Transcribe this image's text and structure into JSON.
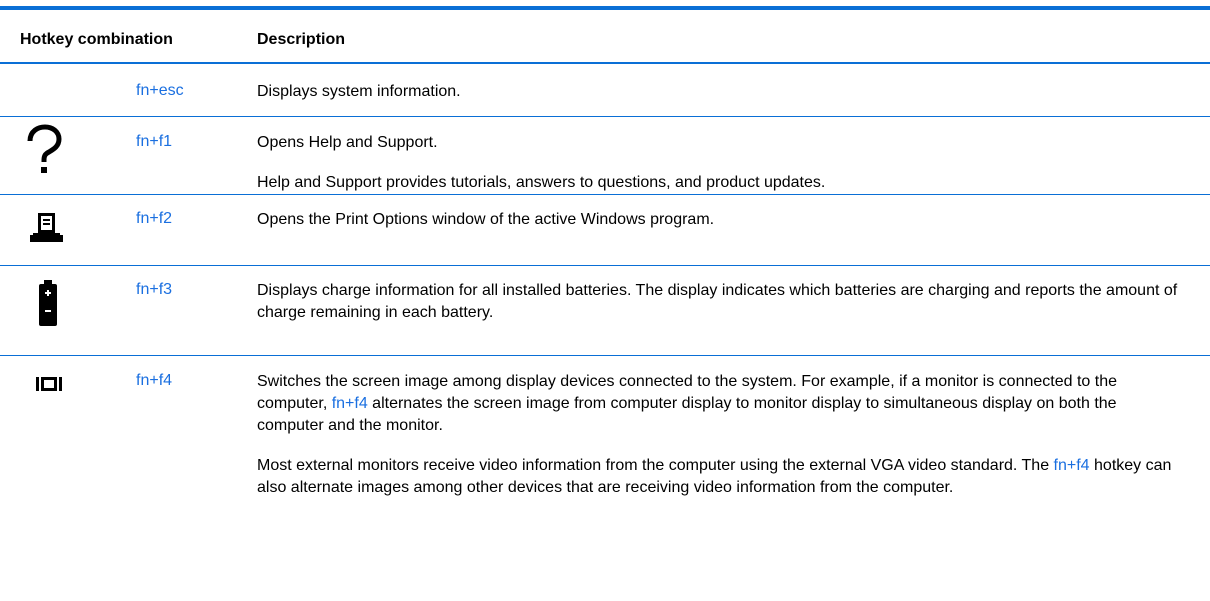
{
  "header": {
    "combo": "Hotkey combination",
    "description": "Description"
  },
  "rows": [
    {
      "icon": "none",
      "key": "fn+esc",
      "paragraphs": [
        "Displays system information."
      ]
    },
    {
      "icon": "help-question-icon",
      "key": "fn+f1",
      "paragraphs": [
        "Opens Help and Support.",
        "Help and Support provides tutorials, answers to questions, and product updates."
      ]
    },
    {
      "icon": "print-icon",
      "key": "fn+f2",
      "paragraphs": [
        "Opens the Print Options window of the active Windows program."
      ]
    },
    {
      "icon": "battery-icon",
      "key": "fn+f3",
      "paragraphs": [
        "Displays charge information for all installed batteries. The display indicates which batteries are charging and reports the amount of charge remaining in each battery."
      ]
    },
    {
      "icon": "display-switch-icon",
      "key": "fn+f4",
      "p1_before": "Switches the screen image among display devices connected to the system. For example, if a monitor is connected to the computer, ",
      "p1_key": "fn+f4",
      "p1_after": " alternates the screen image from computer display to monitor display to simultaneous display on both the computer and the monitor.",
      "p2_before": "Most external monitors receive video information from the computer using the external VGA video standard. The ",
      "p2_key": "fn+f4",
      "p2_after": " hotkey can also alternate images among other devices that are receiving video information from the computer."
    }
  ],
  "colors": {
    "accent": "#0a6fd6",
    "link": "#1a6fe0"
  }
}
